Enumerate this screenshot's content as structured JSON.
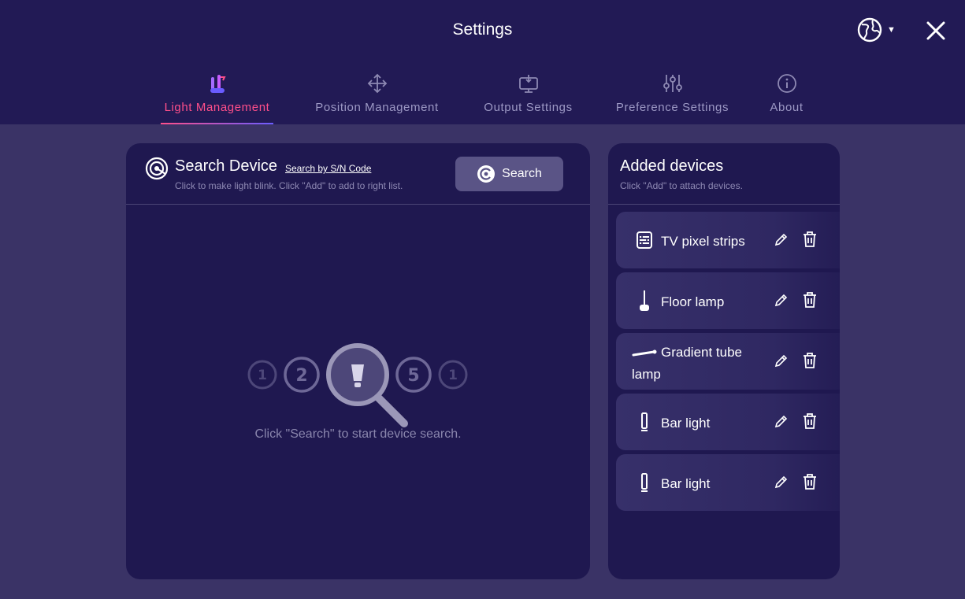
{
  "window": {
    "title": "Settings"
  },
  "tabs": [
    {
      "label": "Light Management",
      "icon": "lamps-icon",
      "active": true
    },
    {
      "label": "Position Management",
      "icon": "move-arrows-icon",
      "active": false
    },
    {
      "label": "Output Settings",
      "icon": "monitor-output-icon",
      "active": false
    },
    {
      "label": "Preference Settings",
      "icon": "sliders-icon",
      "active": false
    },
    {
      "label": "About",
      "icon": "info-icon",
      "active": false
    }
  ],
  "search_panel": {
    "title": "Search Device",
    "sn_link": "Search by S/N Code",
    "hint": "Click to make light blink. Click \"Add\" to add to right list.",
    "search_button": "Search",
    "empty_text": "Click \"Search\" to start device search."
  },
  "added_panel": {
    "title": "Added devices",
    "hint": "Click \"Add\" to attach devices.",
    "devices": [
      {
        "name": "TV pixel strips",
        "icon": "pixel-strip-icon"
      },
      {
        "name": "Floor lamp",
        "icon": "floor-lamp-icon"
      },
      {
        "name": "Gradient tube lamp",
        "icon": "gradient-tube-icon"
      },
      {
        "name": "Bar light",
        "icon": "bar-light-icon"
      },
      {
        "name": "Bar light",
        "icon": "bar-light-icon"
      }
    ]
  },
  "colors": {
    "accent": "#ff4f8a",
    "header_bg": "#221a55",
    "page_bg": "#3a3366",
    "panel_bg": "#1f1850"
  }
}
